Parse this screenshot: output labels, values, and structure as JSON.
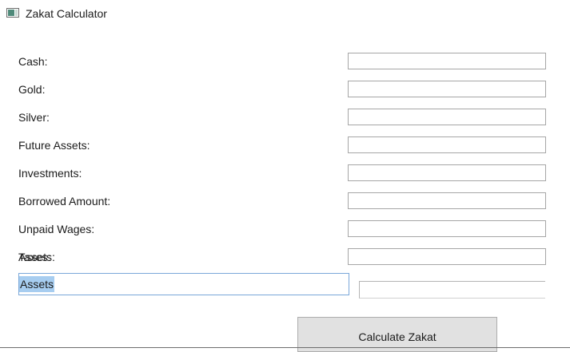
{
  "window": {
    "title": "Zakat Calculator",
    "icon": "app-window-icon"
  },
  "form": {
    "fields": [
      {
        "label": "Cash:",
        "value": ""
      },
      {
        "label": "Gold:",
        "value": ""
      },
      {
        "label": "Silver:",
        "value": ""
      },
      {
        "label": "Future Assets:",
        "value": ""
      },
      {
        "label": "Investments:",
        "value": ""
      },
      {
        "label": "Borrowed Amount:",
        "value": ""
      },
      {
        "label": "Unpaid Wages:",
        "value": ""
      },
      {
        "label": "Taxes:",
        "value": ""
      }
    ],
    "overlapping_label": "Assets:",
    "assets_input_value": "Assets",
    "result_value": ""
  },
  "actions": {
    "calculate_label": "Calculate Zakat"
  },
  "colors": {
    "selection": "#a7cdf0",
    "focus_border": "#7aa7d9",
    "button_bg": "#e1e1e1"
  }
}
